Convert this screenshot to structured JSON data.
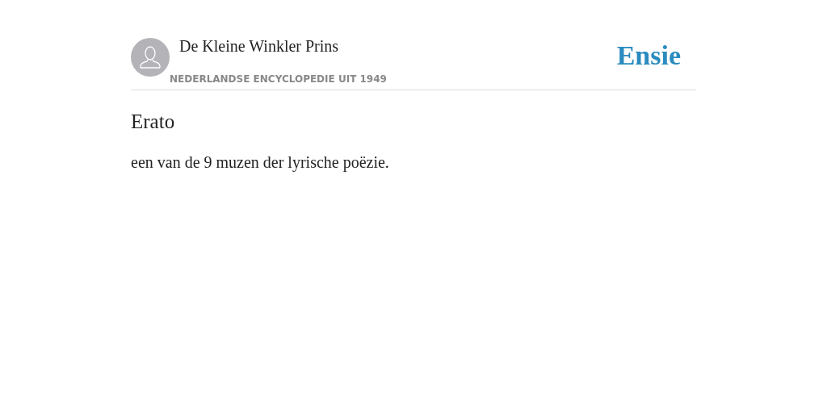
{
  "header": {
    "title": "De Kleine Winkler Prins",
    "subtitle": "NEDERLANDSE ENCYCLOPEDIE UIT 1949",
    "logo": "Ensie"
  },
  "article": {
    "heading": "Erato",
    "body": "een van de 9 muzen der lyrische poëzie."
  }
}
